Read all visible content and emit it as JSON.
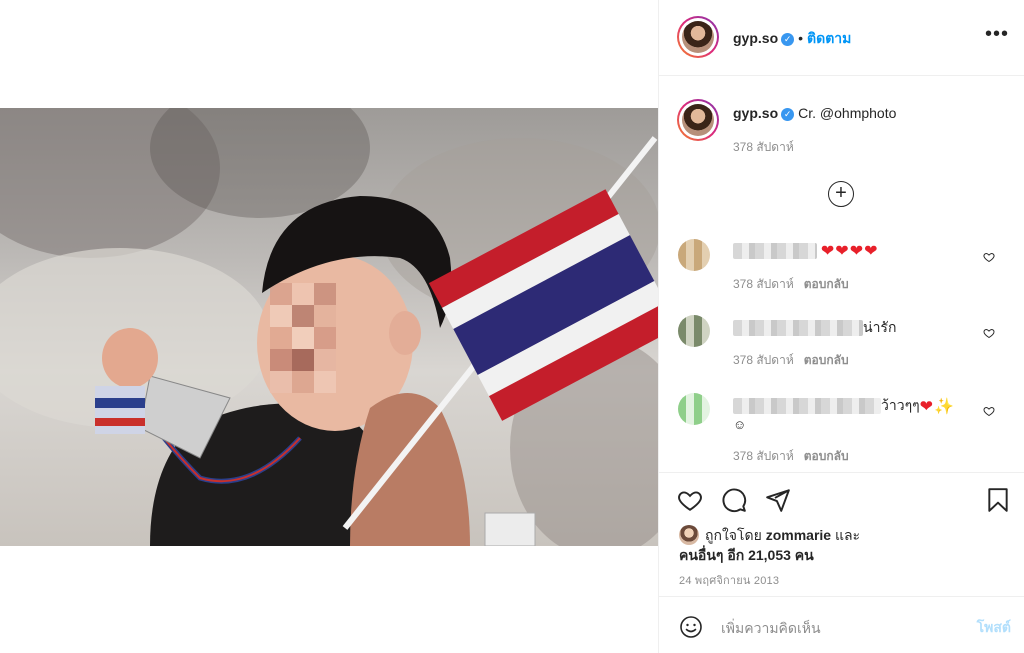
{
  "post": {
    "photo_alt": ""
  },
  "header": {
    "username": "gyp.so",
    "verified_mark": "✓",
    "dot": "•",
    "follow_label": "ติดตาม",
    "more_label": "•••"
  },
  "caption": {
    "username": "gyp.so",
    "verified_mark": "✓",
    "text": "Cr. @ohmphoto",
    "time": "378 สัปดาห์"
  },
  "load_more_label": "+",
  "comments": [
    {
      "text": "",
      "emoji": "❤❤❤❤",
      "time": "378 สัปดาห์",
      "reply": "ตอบกลับ"
    },
    {
      "text": "น่ารัก",
      "time": "378 สัปดาห์",
      "reply": "ตอบกลับ"
    },
    {
      "text": "ว้าวๆๆ",
      "emoji": "❤✨",
      "extra": "☺",
      "time": "378 สัปดาห์",
      "reply": "ตอบกลับ"
    }
  ],
  "likes": {
    "prefix": "ถูกใจโดย",
    "user": "zommarie",
    "and": "และ",
    "others": "คนอื่นๆ อีก 21,053 คน"
  },
  "date": "24 พฤศจิกายน 2013",
  "comment_box": {
    "placeholder": "เพิ่มความคิดเห็น",
    "post_label": "โพสต์"
  },
  "icons": [
    "heart-icon",
    "comment-icon",
    "share-icon",
    "bookmark-icon",
    "emoji-icon",
    "more-icon"
  ],
  "colors": {
    "accent": "#0095f6",
    "verified": "#3897f0",
    "heart": "#e8202a",
    "post_disabled": "#b2dffc"
  }
}
